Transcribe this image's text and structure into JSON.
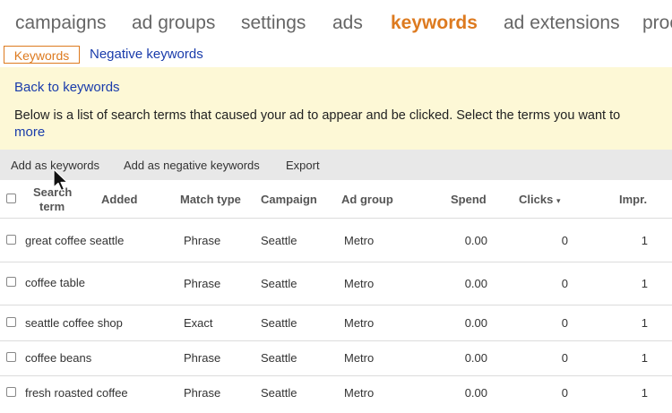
{
  "nav": {
    "tabs": [
      {
        "label": "campaigns",
        "active": false
      },
      {
        "label": "ad groups",
        "active": false
      },
      {
        "label": "settings",
        "active": false
      },
      {
        "label": "ads",
        "active": false
      },
      {
        "label": "keywords",
        "active": true
      },
      {
        "label": "ad extensions",
        "active": false
      },
      {
        "label": "proc",
        "active": false
      }
    ],
    "active_color": "#dd7a1f"
  },
  "subtabs": {
    "keywords": "Keywords",
    "negative": "Negative keywords"
  },
  "notice": {
    "back_link": "Back to keywords",
    "description": "Below is a list of search terms that caused your ad to appear and be clicked. Select the terms you want to",
    "more_link": "more"
  },
  "toolbar": {
    "add_keywords": "Add as keywords",
    "add_negative": "Add as negative keywords",
    "export": "Export"
  },
  "table": {
    "headers": {
      "search_term_line1": "Search",
      "search_term_line2": "term",
      "added": "Added",
      "match_type": "Match type",
      "campaign": "Campaign",
      "ad_group": "Ad group",
      "spend": "Spend",
      "clicks": "Clicks",
      "clicks_sort": "▾",
      "impr": "Impr."
    },
    "rows": [
      {
        "term": "great coffee seattle",
        "match": "Phrase",
        "campaign": "Seattle",
        "ad_group": "Metro",
        "spend": "0.00",
        "clicks": "0",
        "impr": "1"
      },
      {
        "term": "coffee table",
        "match": "Phrase",
        "campaign": "Seattle",
        "ad_group": "Metro",
        "spend": "0.00",
        "clicks": "0",
        "impr": "1"
      },
      {
        "term": "seattle coffee shop",
        "match": "Exact",
        "campaign": "Seattle",
        "ad_group": "Metro",
        "spend": "0.00",
        "clicks": "0",
        "impr": "1"
      },
      {
        "term": "coffee beans",
        "match": "Phrase",
        "campaign": "Seattle",
        "ad_group": "Metro",
        "spend": "0.00",
        "clicks": "0",
        "impr": "1"
      },
      {
        "term": "fresh roasted coffee",
        "match": "Phrase",
        "campaign": "Seattle",
        "ad_group": "Metro",
        "spend": "0.00",
        "clicks": "0",
        "impr": "1"
      }
    ]
  }
}
